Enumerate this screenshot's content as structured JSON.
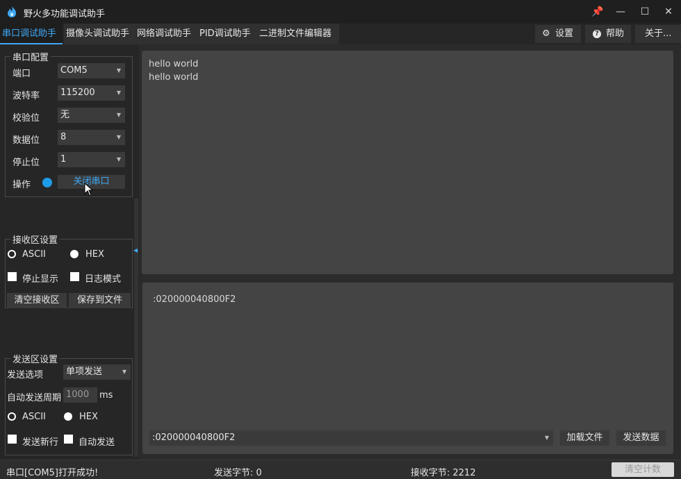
{
  "app": {
    "title": "野火多功能调试助手"
  },
  "window_buttons": {
    "pin": "📌",
    "minimize": "—",
    "maximize": "☐",
    "close": "✕"
  },
  "tabs": [
    {
      "label": "串口调试助手",
      "active": true
    },
    {
      "label": "摄像头调试助手"
    },
    {
      "label": "网络调试助手"
    },
    {
      "label": "PID调试助手"
    },
    {
      "label": "二进制文件编辑器"
    }
  ],
  "toolbar": {
    "settings_icon": "⚙",
    "settings": "设置",
    "help_icon": "?",
    "help": "帮助",
    "about": "关于..."
  },
  "serial_config": {
    "title": "串口配置",
    "port_label": "端口",
    "port_value": "COM5",
    "baud_label": "波特率",
    "baud_value": "115200",
    "parity_label": "校验位",
    "parity_value": "无",
    "databits_label": "数据位",
    "databits_value": "8",
    "stopbits_label": "停止位",
    "stopbits_value": "1",
    "op_label": "操作",
    "op_button": "关闭串口",
    "status_color": "#1e9be8"
  },
  "receive_settings": {
    "title": "接收区设置",
    "ascii": "ASCII",
    "hex": "HEX",
    "stop_display": "停止显示",
    "log_mode": "日志模式",
    "clear_btn": "清空接收区",
    "save_btn": "保存到文件"
  },
  "send_settings": {
    "title": "发送区设置",
    "option_label": "发送选项",
    "option_value": "单项发送",
    "period_label": "自动发送周期",
    "period_value": "1000",
    "period_unit": "ms",
    "ascii": "ASCII",
    "hex": "HEX",
    "newline": "发送新行",
    "auto_send": "自动发送"
  },
  "receive_area": {
    "lines": [
      "hello world",
      "hello world"
    ]
  },
  "send_area": {
    "text": ":020000040800F2",
    "input_value": ":020000040800F2",
    "load_btn": "加载文件",
    "send_btn": "发送数据"
  },
  "status_bar": {
    "message": "串口[COM5]打开成功!",
    "sent": "发送字节: 0",
    "received": "接收字节: 2212",
    "clear_count": "清空计数"
  },
  "colors": {
    "accent": "#3fa9f5",
    "background": "#2b2b2b",
    "panel": "#444444"
  }
}
